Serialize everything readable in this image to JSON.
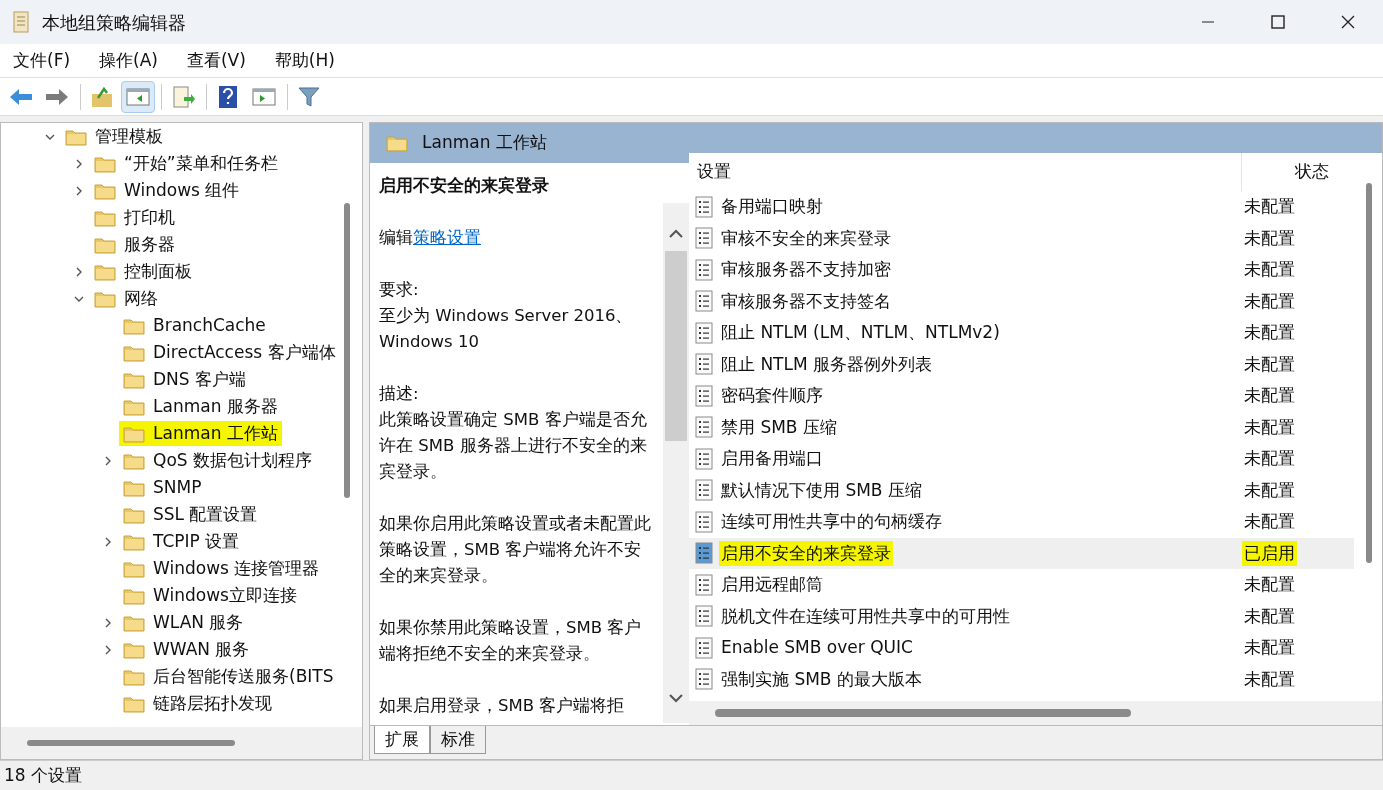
{
  "window": {
    "title": "本地组策略编辑器"
  },
  "menu": [
    "文件(F)",
    "操作(A)",
    "查看(V)",
    "帮助(H)"
  ],
  "toolbar": [
    {
      "pressed": false
    },
    {
      "pressed": false
    },
    {
      "pressed": false
    },
    {
      "pressed": true
    },
    {
      "pressed": false
    },
    {
      "pressed": false
    },
    {
      "pressed": false
    },
    {
      "pressed": false
    }
  ],
  "tree": [
    {
      "label": "管理模板",
      "expanded": true,
      "selected": false,
      "children": [
        {
          "label": "“开始”菜单和任务栏",
          "expanded": false,
          "selected": false
        },
        {
          "label": "Windows 组件",
          "expanded": false,
          "selected": false
        },
        {
          "label": "打印机",
          "selected": false
        },
        {
          "label": "服务器",
          "selected": false
        },
        {
          "label": "控制面板",
          "expanded": false,
          "selected": false
        },
        {
          "label": "网络",
          "expanded": true,
          "selected": false,
          "children": [
            {
              "label": "BranchCache",
              "selected": false
            },
            {
              "label": "DirectAccess 客户端体",
              "selected": false
            },
            {
              "label": "DNS 客户端",
              "selected": false
            },
            {
              "label": "Lanman 服务器",
              "selected": false
            },
            {
              "label": "Lanman 工作站",
              "selected": true
            },
            {
              "label": "QoS 数据包计划程序",
              "expanded": false,
              "selected": false
            },
            {
              "label": "SNMP",
              "selected": false
            },
            {
              "label": "SSL 配置设置",
              "selected": false
            },
            {
              "label": "TCPIP 设置",
              "expanded": false,
              "selected": false
            },
            {
              "label": "Windows 连接管理器",
              "selected": false
            },
            {
              "label": "Windows立即连接",
              "selected": false
            },
            {
              "label": "WLAN 服务",
              "expanded": false,
              "selected": false
            },
            {
              "label": "WWAN 服务",
              "expanded": false,
              "selected": false
            },
            {
              "label": "后台智能传送服务(BITS",
              "selected": false
            },
            {
              "label": "链路层拓扑发现",
              "selected": false
            }
          ]
        }
      ]
    }
  ],
  "header": {
    "title": "Lanman 工作站"
  },
  "description": {
    "heading": "启用不安全的来宾登录",
    "edit_prefix": "编辑",
    "edit_link": "策略设置",
    "requirement_label": "要求:",
    "requirement": "至少为 Windows Server 2016、Windows 10",
    "description_label": "描述:",
    "paragraphs": [
      "此策略设置确定 SMB 客户端是否允许在 SMB 服务器上进行不安全的来宾登录。",
      "如果你启用此策略设置或者未配置此策略设置，SMB 客户端将允许不安全的来宾登录。",
      "如果你禁用此策略设置，SMB 客户端将拒绝不安全的来宾登录。",
      "如果启用登录，SMB 客户端将拒"
    ]
  },
  "table": {
    "columns": [
      "设置",
      "状态"
    ],
    "rows": [
      {
        "name": "备用端口映射",
        "state": "未配置",
        "selected": false
      },
      {
        "name": "审核不安全的来宾登录",
        "state": "未配置",
        "selected": false
      },
      {
        "name": "审核服务器不支持加密",
        "state": "未配置",
        "selected": false
      },
      {
        "name": "审核服务器不支持签名",
        "state": "未配置",
        "selected": false
      },
      {
        "name": "阻止 NTLM (LM、NTLM、NTLMv2)",
        "state": "未配置",
        "selected": false
      },
      {
        "name": "阻止 NTLM 服务器例外列表",
        "state": "未配置",
        "selected": false
      },
      {
        "name": "密码套件顺序",
        "state": "未配置",
        "selected": false
      },
      {
        "name": "禁用 SMB 压缩",
        "state": "未配置",
        "selected": false
      },
      {
        "name": "启用备用端口",
        "state": "未配置",
        "selected": false
      },
      {
        "name": "默认情况下使用 SMB 压缩",
        "state": "未配置",
        "selected": false
      },
      {
        "name": "连续可用性共享中的句柄缓存",
        "state": "未配置",
        "selected": false
      },
      {
        "name": "启用不安全的来宾登录",
        "state": "已启用",
        "selected": true
      },
      {
        "name": "启用远程邮筒",
        "state": "未配置",
        "selected": false
      },
      {
        "name": "脱机文件在连续可用性共享中的可用性",
        "state": "未配置",
        "selected": false
      },
      {
        "name": "Enable SMB over QUIC",
        "state": "未配置",
        "selected": false
      },
      {
        "name": "强制实施 SMB 的最大版本",
        "state": "未配置",
        "selected": false
      }
    ]
  },
  "tabs": [
    {
      "label": "扩展",
      "selected": true
    },
    {
      "label": "标准",
      "selected": false
    }
  ],
  "status_bar": {
    "text": "18 个设置"
  }
}
